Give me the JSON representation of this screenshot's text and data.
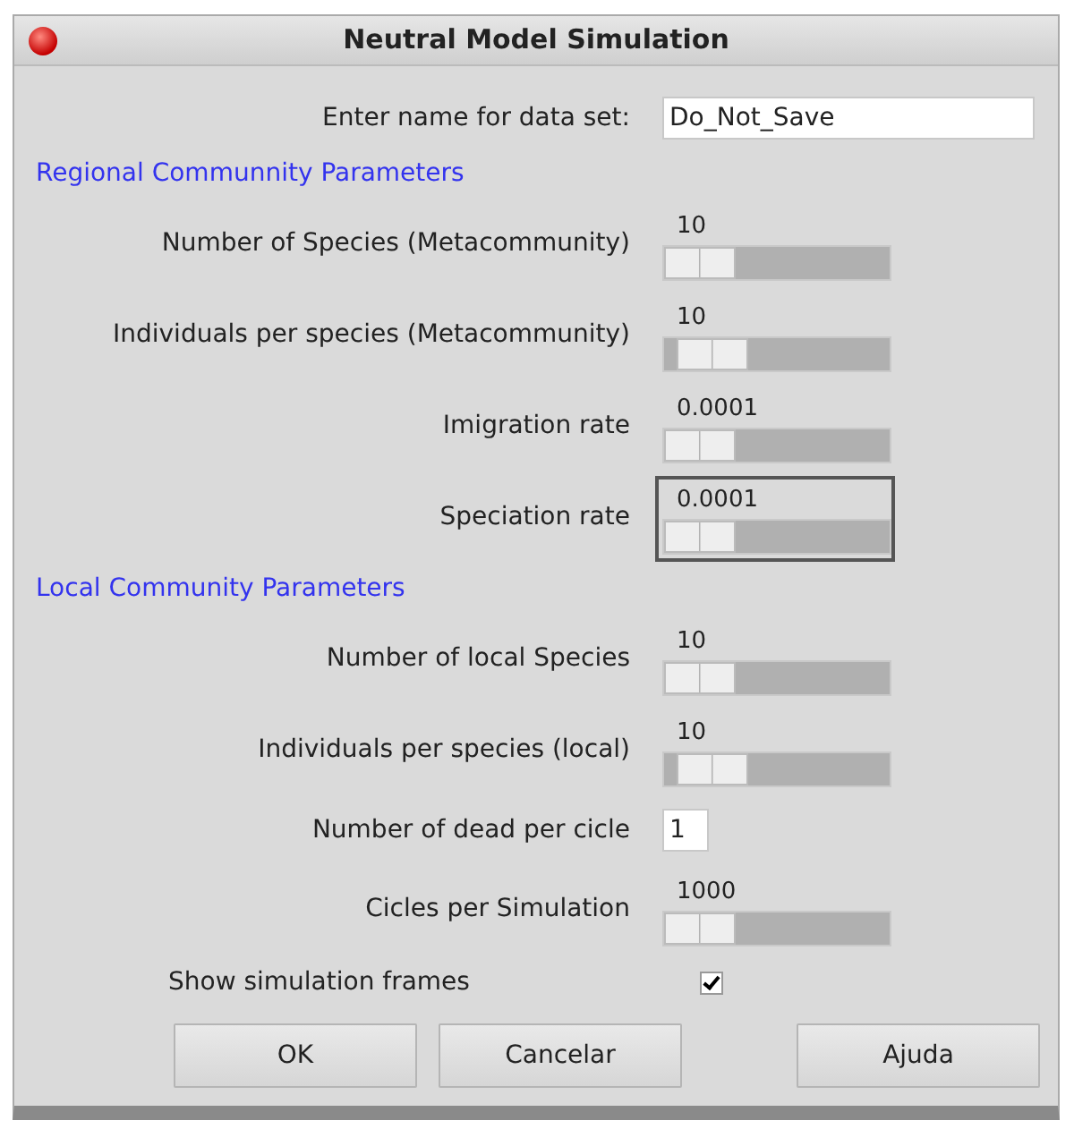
{
  "window": {
    "title": "Neutral Model Simulation"
  },
  "rows": [
    {
      "kind": "text",
      "label": "Enter name for data set:",
      "value": "Do_Not_Save"
    },
    {
      "kind": "heading",
      "label": "Regional Communnity Parameters"
    },
    {
      "kind": "slider",
      "label": "Number of Species (Metacommunity)",
      "reading": "10",
      "level": 0,
      "focused": false
    },
    {
      "kind": "slider",
      "label": "Individuals per species (Metacommunity)",
      "reading": "10",
      "level": 0.08,
      "focused": false
    },
    {
      "kind": "slider",
      "label": "Imigration rate",
      "reading": "0.0001",
      "level": 0,
      "focused": false
    },
    {
      "kind": "slider",
      "label": "Speciation rate",
      "reading": "0.0001",
      "level": 0,
      "focused": true
    },
    {
      "kind": "heading",
      "label": "Local Community Parameters"
    },
    {
      "kind": "slider",
      "label": "Number of local Species",
      "reading": "10",
      "level": 0,
      "focused": false
    },
    {
      "kind": "slider",
      "label": "Individuals per species (local)",
      "reading": "10",
      "level": 0.08,
      "focused": false
    },
    {
      "kind": "number",
      "label": "Number of dead per cicle",
      "value": "1"
    },
    {
      "kind": "slider",
      "label": "Cicles per Simulation",
      "reading": "1000",
      "level": 0,
      "focused": false
    },
    {
      "kind": "checkbox",
      "label": "Show simulation frames",
      "checked": true
    }
  ],
  "buttons": [
    "OK",
    "Cancelar",
    "Ajuda"
  ]
}
